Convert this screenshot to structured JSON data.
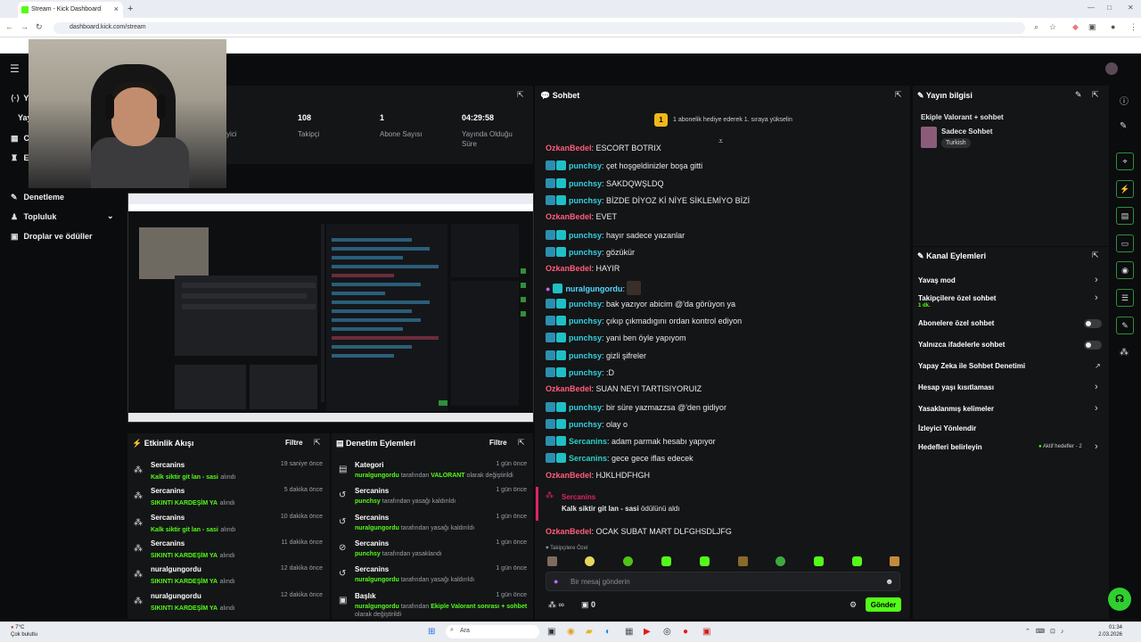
{
  "browser": {
    "tab_title": "Stream - Kick Dashboard",
    "url": "dashboard.kick.com/stream",
    "new_tab": "+",
    "close": "×"
  },
  "sidebar": {
    "items": [
      {
        "label": "Ya",
        "icon": "live-icon"
      },
      {
        "label": "Yay",
        "icon": "none"
      },
      {
        "label": "C",
        "icon": "chart-icon"
      },
      {
        "label": "E",
        "icon": "trophy-icon"
      },
      {
        "label": "Denetleme",
        "icon": "wrench-icon"
      },
      {
        "label": "Topluluk",
        "icon": "users-icon"
      },
      {
        "label": "Droplar ve ödüller",
        "icon": "gift-icon"
      }
    ]
  },
  "stats": {
    "partial_label": "yici",
    "items": [
      {
        "value": "108",
        "label": "Takipçi"
      },
      {
        "value": "1",
        "label": "Abone Sayısı"
      },
      {
        "value": "04:29:58",
        "label": "Yayında Olduğu Süre"
      }
    ]
  },
  "activity_feed": {
    "title": "Etkinlik Akışı",
    "filter": "Filtre",
    "items": [
      {
        "user": "Sercanins",
        "reward": "Kalk siktir git lan - sasi",
        "suffix": "alındı",
        "time": "19 saniye önce"
      },
      {
        "user": "Sercanins",
        "reward": "SIKINTI KARDEŞİM YA",
        "suffix": "alındı",
        "time": "5 dakika önce"
      },
      {
        "user": "Sercanins",
        "reward": "Kalk siktir git lan - sasi",
        "suffix": "alındı",
        "time": "10 dakika önce"
      },
      {
        "user": "Sercanins",
        "reward": "SIKINTI KARDEŞİM YA",
        "suffix": "alındı",
        "time": "11 dakika önce"
      },
      {
        "user": "nuralgungordu",
        "reward": "SIKINTI KARDEŞİM YA",
        "suffix": "alındı",
        "time": "12 dakika önce"
      },
      {
        "user": "nuralgungordu",
        "reward": "SIKINTI KARDEŞİM YA",
        "suffix": "alındı",
        "time": "12 dakika önce"
      }
    ]
  },
  "mod_actions": {
    "title": "Denetim Eylemleri",
    "filter": "Filtre",
    "items": [
      {
        "title": "Kategori",
        "actor": "nuralgungordu",
        "mid": "tarafından",
        "target": "VALORANT",
        "tail": "olarak değiştirildi",
        "time": "1 gün önce"
      },
      {
        "title": "Sercanins",
        "actor": "punchsy",
        "mid": "tarafından yasağı kaldırıldı",
        "target": "",
        "tail": "",
        "time": "1 gün önce"
      },
      {
        "title": "Sercanins",
        "actor": "nuralgungordu",
        "mid": "tarafından yasağı kaldırıldı",
        "target": "",
        "tail": "",
        "time": "1 gün önce"
      },
      {
        "title": "Sercanins",
        "actor": "punchsy",
        "mid": "tarafından yasaklandı",
        "target": "",
        "tail": "",
        "time": "1 gün önce"
      },
      {
        "title": "Sercanins",
        "actor": "nuralgungordu",
        "mid": "tarafından yasağı kaldırıldı",
        "target": "",
        "tail": "",
        "time": "1 gün önce"
      },
      {
        "title": "Başlık",
        "actor": "nuralgungordu",
        "mid": "tarafından",
        "target": "Ekiple Valorant sonrası + sohbet",
        "tail": "olarak değiştirildi",
        "time": "1 gün önce"
      }
    ]
  },
  "chat": {
    "title": "Sohbet",
    "gift_banner_num": "1",
    "gift_banner": "1 abonelik hediye ederek 1. sıraya yükselin",
    "messages": [
      {
        "user": "OzkanBedel",
        "type": "ozk",
        "text": "ESCORT BOTRIX"
      },
      {
        "user": "punchsy",
        "type": "pun",
        "text": "çet hoşgeldinizler boşa gitti"
      },
      {
        "user": "punchsy",
        "type": "pun",
        "text": "SAKDQWŞLDQ"
      },
      {
        "user": "punchsy",
        "type": "pun",
        "text": "BİZDE DİYOZ Kİ NİYE SİKLEMİYO BİZİ"
      },
      {
        "user": "OzkanBedel",
        "type": "ozk",
        "text": "EVET"
      },
      {
        "user": "punchsy",
        "type": "pun",
        "text": "hayır sadece yazanlar"
      },
      {
        "user": "punchsy",
        "type": "pun",
        "text": "gözükür"
      },
      {
        "user": "OzkanBedel",
        "type": "ozk",
        "text": "HAYIR"
      },
      {
        "user": "nuralgungordu",
        "type": "nur",
        "text": ""
      },
      {
        "user": "punchsy",
        "type": "pun",
        "text": "bak yazıyor abicim @'da görüyon ya"
      },
      {
        "user": "punchsy",
        "type": "pun",
        "text": "çıkıp çıkmadıgını ordan kontrol ediyon"
      },
      {
        "user": "punchsy",
        "type": "pun",
        "text": "yani ben öyle yapıyom"
      },
      {
        "user": "punchsy",
        "type": "pun",
        "text": "gizli şifreler"
      },
      {
        "user": "punchsy",
        "type": "pun",
        "text": ":D"
      },
      {
        "user": "OzkanBedel",
        "type": "ozk",
        "text": "SUAN NEYI TARTISIYORUIZ"
      },
      {
        "user": "punchsy",
        "type": "pun",
        "text": "bir süre yazmazzsa @'den gidiyor"
      },
      {
        "user": "punchsy",
        "type": "pun",
        "text": "olay o"
      },
      {
        "user": "Sercanins",
        "type": "ser",
        "text": "adam parmak hesabı yapıyor"
      },
      {
        "user": "Sercanins",
        "type": "ser",
        "text": "gece gece iflas edecek"
      },
      {
        "user": "OzkanBedel",
        "type": "ozk",
        "text": "HJKLHDFHGH"
      }
    ],
    "redeem_user": "Sercanins",
    "redeem_reward": "Kalk siktir git lan - sasi",
    "redeem_tail": "ödülünü aldı",
    "last_user": "OzkanBedel",
    "last_text": "OCAK SUBAT MART DLFGHSDLJFG",
    "followers_only": "Takipçilere Özel",
    "input_placeholder": "Bir mesaj gönderin",
    "points": "∞",
    "count": "0",
    "send": "Gönder"
  },
  "stream_info": {
    "title": "Yayın bilgisi",
    "stream_title": "Ekiple Valorant + sohbet",
    "category": "Sadece Sohbet",
    "tag": "Turkish"
  },
  "channel_actions": {
    "title": "Kanal Eylemleri",
    "items": [
      {
        "label": "Yavaş mod",
        "kind": "chev",
        "sub": ""
      },
      {
        "label": "Takipçilere özel sohbet",
        "kind": "chev",
        "sub": "1 dk."
      },
      {
        "label": "Abonelere özel sohbet",
        "kind": "toggle",
        "sub": ""
      },
      {
        "label": "Yalnızca ifadelerle sohbet",
        "kind": "toggle",
        "sub": ""
      },
      {
        "label": "Yapay Zeka ile Sohbet Denetimi",
        "kind": "ext",
        "sub": ""
      },
      {
        "label": "Hesap yaşı kısıtlaması",
        "kind": "chev",
        "sub": ""
      },
      {
        "label": "Yasaklanmış kelimeler",
        "kind": "chev",
        "sub": ""
      },
      {
        "label": "İzleyici Yönlendir",
        "kind": "none",
        "sub": ""
      },
      {
        "label": "Hedefleri belirleyin",
        "kind": "chev",
        "sub": ""
      }
    ],
    "goals_status": "Aktif hedefler - 2"
  },
  "taskbar": {
    "weather_temp": "7°C",
    "weather_desc": "Çok bulutlu",
    "search": "Ara",
    "time": "01:34",
    "date": "2.03.2026"
  },
  "accent": "#53fc18"
}
